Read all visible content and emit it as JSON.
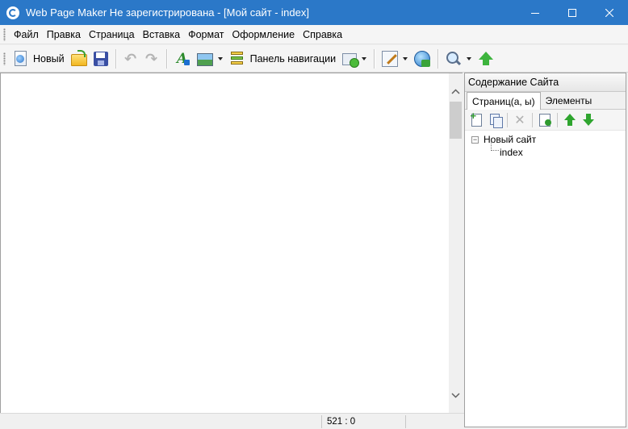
{
  "window": {
    "title": "Web Page Maker Не зарегистрирована - [Мой сайт - index]"
  },
  "menu": {
    "items": [
      "Файл",
      "Правка",
      "Страница",
      "Вставка",
      "Формат",
      "Оформление",
      "Справка"
    ]
  },
  "toolbar": {
    "new_label": "Новый",
    "nav_panel_label": "Панель навигации"
  },
  "panel": {
    "title": "Содержание Сайта",
    "tabs": [
      "Страниц(а, ы)",
      "Элементы"
    ],
    "active_tab": "Страниц(а, ы)"
  },
  "tree": {
    "root": "Новый сайт",
    "root_expander": "−",
    "pages": [
      "index"
    ]
  },
  "status": {
    "coordinates": "521 : 0"
  },
  "icons": {
    "app": "web-page-maker-logo",
    "new": "new-page-icon",
    "open": "open-folder-icon",
    "save": "floppy-disk-icon",
    "undo": "undo-icon",
    "redo": "redo-icon",
    "font": "font-style-icon",
    "image": "insert-image-icon",
    "navigation": "navigation-bar-icon",
    "shape": "shape-icon",
    "edit": "edit-page-icon",
    "publish": "publish-globe-icon",
    "zoom": "zoom-icon",
    "upload": "upload-arrow-icon"
  },
  "colors": {
    "titlebar": "#2b78c8",
    "accent_green": "#3db43d"
  }
}
